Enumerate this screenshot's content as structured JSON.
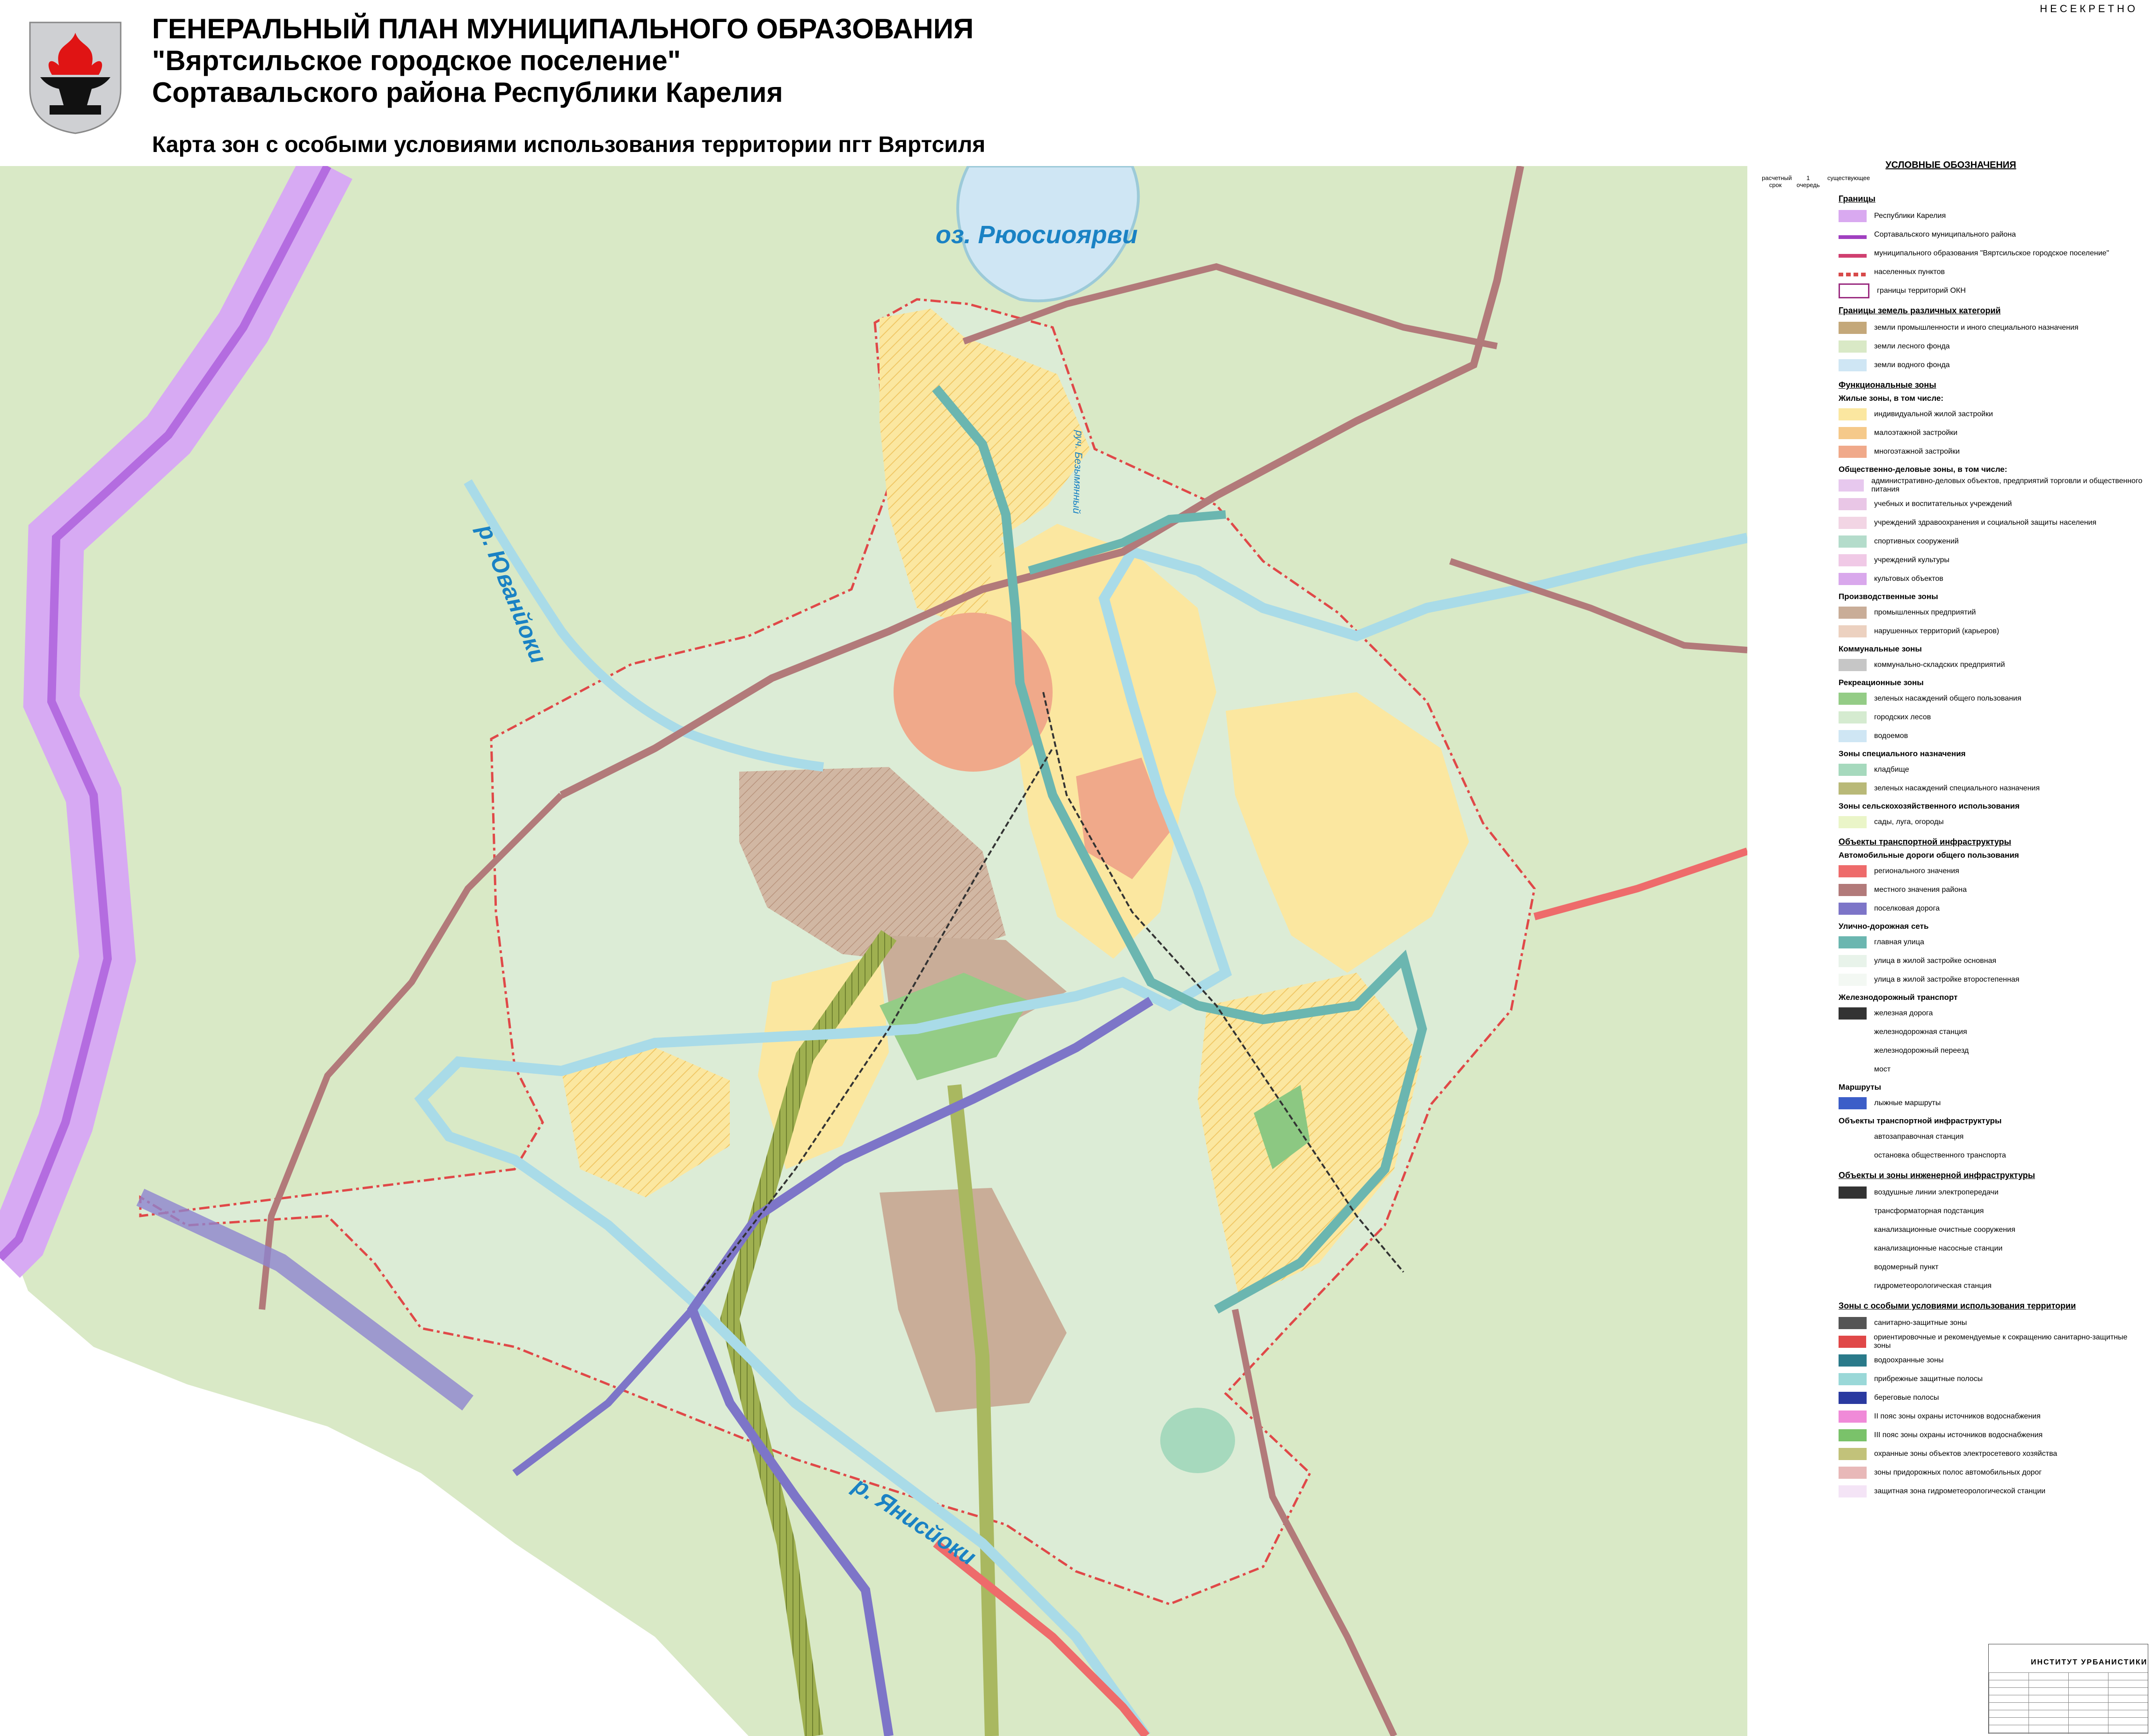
{
  "header": {
    "classification": "НЕСЕКРЕТНО",
    "title_line1": "ГЕНЕРАЛЬНЫЙ ПЛАН МУНИЦИПАЛЬНОГО ОБРАЗОВАНИЯ",
    "title_line2": "\"Вяртсильское городское поселение\"",
    "title_line3": "Сортавальского района Республики Карелия",
    "subtitle": "Карта зон с особыми условиями использования территории пгт Вяртсиля"
  },
  "map_labels": {
    "lake": "оз. Рюосиоярви",
    "river_west": "р. Юванйоки",
    "river_south": "р. Янисйоки",
    "stream": "руч. Безымянный"
  },
  "colors": {
    "forest": "#d9e9c6",
    "settlement": "#dcebd5",
    "residential_individual": "#fbe9a0",
    "residential_low": "#f5c98a",
    "residential_multi": "#f0a98a",
    "industrial": "#c9a994",
    "water": "#cfe8f2",
    "road_regional": "#e85c5c",
    "road_district": "#b07a7a",
    "road_settlement": "#7d75c8",
    "main_street": "#6bb6b0",
    "republic_border": "#d6a9f2",
    "settlement_border": "#d84a4a"
  },
  "legend": {
    "header": "УСЛОВНЫЕ ОБОЗНАЧЕНИЯ",
    "col_headers": [
      "расчетный срок",
      "1 очередь",
      "существующее"
    ],
    "sections": [
      {
        "title": "Границы",
        "items": [
          {
            "label": "Республики Карелия",
            "color": "#d9a9f0",
            "type": "fill"
          },
          {
            "label": "Сортавальского муниципального района",
            "color": "#a040c0",
            "type": "line"
          },
          {
            "label": "муниципального образования \"Вяртсильское городское поселение\"",
            "color": "#d04070",
            "type": "line"
          },
          {
            "label": "населенных пунктов",
            "color": "#d84a4a",
            "type": "dash"
          },
          {
            "label": "границы территорий ОКН",
            "color": "#9a2c80",
            "type": "outline"
          }
        ]
      },
      {
        "title": "Границы земель различных категорий",
        "items": [
          {
            "label": "земли промышленности и иного специального назначения",
            "color": "#c4a87a",
            "type": "fill"
          },
          {
            "label": "земли лесного фонда",
            "color": "#d9e9c6",
            "type": "fill"
          },
          {
            "label": "земли водного фонда",
            "color": "#cfe6f4",
            "type": "fill"
          }
        ]
      },
      {
        "title": "Функциональные зоны",
        "subsections": [
          {
            "title": "Жилые зоны,  в том числе:",
            "items": [
              {
                "label": "индивидуальной жилой застройки",
                "color": "#fbe7a0"
              },
              {
                "label": "малоэтажной застройки",
                "color": "#f5c98a"
              },
              {
                "label": "многоэтажной застройки",
                "color": "#f0a98a"
              }
            ]
          },
          {
            "title": "Общественно-деловые зоны,  в том числе:",
            "items": [
              {
                "label": "административно-деловых объектов, предприятий торговли и общественного питания",
                "color": "#e7c8ee"
              },
              {
                "label": "учебных и воспитательных учреждений",
                "color": "#e9c6e6"
              },
              {
                "label": "учреждений здравоохранения и социальной защиты населения",
                "color": "#f2d5e4"
              },
              {
                "label": "спортивных сооружений",
                "color": "#b4dccb"
              },
              {
                "label": "учреждений культуры",
                "color": "#f0c9e6"
              },
              {
                "label": "культовых объектов",
                "color": "#d9a8ec"
              }
            ]
          },
          {
            "title": "Производственные зоны",
            "items": [
              {
                "label": "промышленных предприятий",
                "color": "#c9ad98"
              },
              {
                "label": "нарушенных территорий (карьеров)",
                "color": "#ecd1c0"
              }
            ]
          },
          {
            "title": "Коммунальные зоны",
            "items": [
              {
                "label": "коммунально-складских предприятий",
                "color": "#c6c6c6"
              }
            ]
          },
          {
            "title": "Рекреационные зоны",
            "items": [
              {
                "label": "зеленых насаждений общего пользования",
                "color": "#94cc86"
              },
              {
                "label": "городских лесов",
                "color": "#d5ebd0"
              },
              {
                "label": "водоемов",
                "color": "#cfe6f4"
              }
            ]
          },
          {
            "title": "Зоны специального назначения",
            "items": [
              {
                "label": "кладбище",
                "color": "#a6d9bd"
              },
              {
                "label": "зеленых насаждений специального назначения",
                "color": "#b9b978"
              }
            ]
          },
          {
            "title": "Зоны сельскохозяйственного использования",
            "items": [
              {
                "label": "сады, луга, огороды",
                "color": "#eaf5c8"
              }
            ]
          }
        ]
      },
      {
        "title": "Объекты транспортной инфраструктуры",
        "subsections": [
          {
            "title": "Автомобильные дороги общего пользования",
            "items": [
              {
                "label": "регионального значения",
                "color": "#ee6b6b"
              },
              {
                "label": "местного значения района",
                "color": "#b27a7a"
              },
              {
                "label": "поселковая дорога",
                "color": "#7d75c8"
              }
            ]
          },
          {
            "title": "Улично-дорожная сеть",
            "items": [
              {
                "label": "главная улица",
                "color": "#6bb6b0"
              },
              {
                "label": "улица в жилой застройке основная",
                "color": "#e8f3ea"
              },
              {
                "label": "улица в жилой застройке второстепенная",
                "color": "#f3f8f3"
              }
            ]
          },
          {
            "title": "Железнодорожный транспорт",
            "items": [
              {
                "label": "железная дорога",
                "color": "#333333"
              },
              {
                "label": "железнодорожная станция",
                "color": "#ffffff"
              },
              {
                "label": "железнодорожный переезд",
                "color": "#ffffff"
              },
              {
                "label": "мост",
                "color": "#ffffff"
              }
            ]
          },
          {
            "title": "Маршруты",
            "items": [
              {
                "label": "лыжные маршруты",
                "color": "#3c5ec8"
              }
            ]
          },
          {
            "title": "Объекты транспортной инфраструктуры",
            "items": [
              {
                "label": "автозаправочная станция",
                "color": "#ffffff"
              },
              {
                "label": "остановка общественного транспорта",
                "color": "#ffffff"
              }
            ]
          }
        ]
      },
      {
        "title": "Объекты и зоны инженерной инфраструктуры",
        "items": [
          {
            "label": "воздушные линии электропередачи",
            "color": "#333333"
          },
          {
            "label": "трансформаторная подстанция",
            "color": "#ffffff"
          },
          {
            "label": "канализационные очистные сооружения",
            "color": "#ffffff"
          },
          {
            "label": "канализационные насосные станции",
            "color": "#ffffff"
          },
          {
            "label": "водомерный пункт",
            "color": "#ffffff"
          },
          {
            "label": "гидрометеорологическая станция",
            "color": "#ffffff"
          }
        ]
      },
      {
        "title": "Зоны с особыми условиями использования территории",
        "items": [
          {
            "label": "санитарно-защитные зоны",
            "color": "#555555"
          },
          {
            "label": "ориентировочные и рекомендуемые к сокращению санитарно-защитные зоны",
            "color": "#e04848"
          },
          {
            "label": "водоохранные зоны",
            "color": "#2a7a8a"
          },
          {
            "label": "прибрежные защитные полосы",
            "color": "#9ad8d8"
          },
          {
            "label": "береговые полосы",
            "color": "#2a3aa0"
          },
          {
            "label": "II пояс зоны охраны источников водоснабжения",
            "color": "#f08ad8"
          },
          {
            "label": "III пояс зоны охраны источников водоснабжения",
            "color": "#7ac26a"
          },
          {
            "label": "охранные зоны объектов электросетевого хозяйства",
            "color": "#c2c27a"
          },
          {
            "label": "зоны придорожных полос автомобильных дорог",
            "color": "#e8b8b8"
          },
          {
            "label": "защитная зона гидрометеорологической станции",
            "color": "#f4e4f6"
          }
        ]
      }
    ]
  },
  "stamp": {
    "institute": "ИНСТИТУТ УРБАНИСТИКИ"
  }
}
